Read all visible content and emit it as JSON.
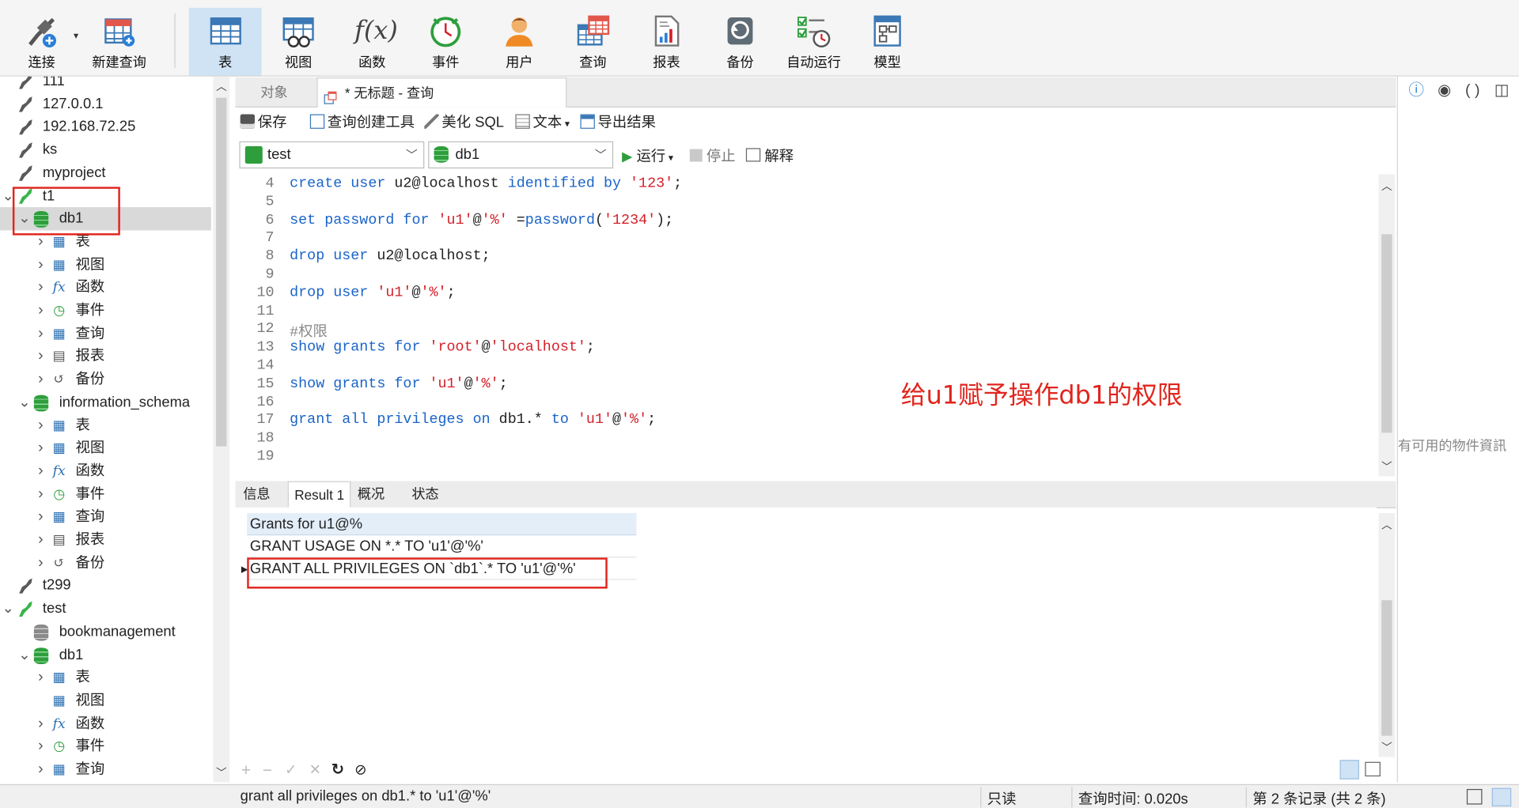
{
  "toolbar": {
    "items": [
      {
        "label": "连接",
        "icon": "plug-icon"
      },
      {
        "label": "新建查询",
        "icon": "new-query-icon"
      },
      {
        "label": "表",
        "icon": "table-icon"
      },
      {
        "label": "视图",
        "icon": "view-icon"
      },
      {
        "label": "函数",
        "icon": "function-icon"
      },
      {
        "label": "事件",
        "icon": "clock-icon"
      },
      {
        "label": "用户",
        "icon": "user-icon"
      },
      {
        "label": "查询",
        "icon": "query-icon"
      },
      {
        "label": "报表",
        "icon": "report-icon"
      },
      {
        "label": "备份",
        "icon": "backup-icon"
      },
      {
        "label": "自动运行",
        "icon": "schedule-icon"
      },
      {
        "label": "模型",
        "icon": "model-icon"
      }
    ],
    "active": "表"
  },
  "tree": {
    "rows": [
      {
        "label": "111",
        "kind": "connection",
        "state": "off"
      },
      {
        "label": "127.0.0.1",
        "kind": "connection",
        "state": "off"
      },
      {
        "label": "192.168.72.25",
        "kind": "connection",
        "state": "off"
      },
      {
        "label": "ks",
        "kind": "connection",
        "state": "off"
      },
      {
        "label": "myproject",
        "kind": "connection",
        "state": "off"
      },
      {
        "label": "t1",
        "kind": "connection",
        "state": "on",
        "expanded": true
      },
      {
        "label": "db1",
        "kind": "database",
        "state": "open",
        "expanded": true,
        "selected": true
      },
      {
        "label": "表",
        "kind": "tables"
      },
      {
        "label": "视图",
        "kind": "views"
      },
      {
        "label": "函数",
        "kind": "functions"
      },
      {
        "label": "事件",
        "kind": "events"
      },
      {
        "label": "查询",
        "kind": "queries"
      },
      {
        "label": "报表",
        "kind": "reports"
      },
      {
        "label": "备份",
        "kind": "backups"
      },
      {
        "label": "information_schema",
        "kind": "database",
        "state": "open",
        "expanded": true
      },
      {
        "label": "表",
        "kind": "tables"
      },
      {
        "label": "视图",
        "kind": "views"
      },
      {
        "label": "函数",
        "kind": "functions"
      },
      {
        "label": "事件",
        "kind": "events"
      },
      {
        "label": "查询",
        "kind": "queries"
      },
      {
        "label": "报表",
        "kind": "reports"
      },
      {
        "label": "备份",
        "kind": "backups"
      },
      {
        "label": "t299",
        "kind": "connection",
        "state": "off"
      },
      {
        "label": "test",
        "kind": "connection",
        "state": "on",
        "expanded": true
      },
      {
        "label": "bookmanagement",
        "kind": "database",
        "state": "closed"
      },
      {
        "label": "db1",
        "kind": "database",
        "state": "open",
        "expanded": true
      },
      {
        "label": "表",
        "kind": "tables"
      },
      {
        "label": "视图",
        "kind": "views"
      },
      {
        "label": "函数",
        "kind": "functions"
      },
      {
        "label": "事件",
        "kind": "events"
      },
      {
        "label": "查询",
        "kind": "queries"
      }
    ]
  },
  "tabs": {
    "objects": "对象",
    "query": "* 无标题 - 查询"
  },
  "query_toolbar": {
    "save": "保存",
    "builder": "查询创建工具",
    "beautify": "美化 SQL",
    "text": "文本",
    "export": "导出结果",
    "connection": "test",
    "database": "db1",
    "run": "运行",
    "stop": "停止",
    "explain": "解释"
  },
  "editor": {
    "lines": [
      {
        "n": "4",
        "tokens": [
          [
            "kw",
            "create user "
          ],
          [
            "plain",
            "u2@localhost "
          ],
          [
            "kw",
            "identified by "
          ],
          [
            "str",
            "'123'"
          ],
          [
            "plain",
            ";"
          ]
        ]
      },
      {
        "n": "5",
        "tokens": []
      },
      {
        "n": "6",
        "tokens": [
          [
            "kw",
            "set password for "
          ],
          [
            "str",
            "'u1'"
          ],
          [
            "plain",
            "@"
          ],
          [
            "str",
            "'%'"
          ],
          [
            "plain",
            " ="
          ],
          [
            "kw",
            "password"
          ],
          [
            "plain",
            "("
          ],
          [
            "str",
            "'1234'"
          ],
          [
            "plain",
            ");"
          ]
        ]
      },
      {
        "n": "7",
        "tokens": []
      },
      {
        "n": "8",
        "tokens": [
          [
            "kw",
            "drop user "
          ],
          [
            "plain",
            "u2@localhost;"
          ]
        ]
      },
      {
        "n": "9",
        "tokens": []
      },
      {
        "n": "10",
        "tokens": [
          [
            "kw",
            "drop user "
          ],
          [
            "str",
            "'u1'"
          ],
          [
            "plain",
            "@"
          ],
          [
            "str",
            "'%'"
          ],
          [
            "plain",
            ";"
          ]
        ]
      },
      {
        "n": "11",
        "tokens": []
      },
      {
        "n": "12",
        "tokens": [
          [
            "cmt",
            "#权限"
          ]
        ]
      },
      {
        "n": "13",
        "tokens": [
          [
            "kw",
            "show grants for "
          ],
          [
            "str",
            "'root'"
          ],
          [
            "plain",
            "@"
          ],
          [
            "str",
            "'localhost'"
          ],
          [
            "plain",
            ";"
          ]
        ]
      },
      {
        "n": "14",
        "tokens": []
      },
      {
        "n": "15",
        "tokens": [
          [
            "kw",
            "show grants for "
          ],
          [
            "str",
            "'u1'"
          ],
          [
            "plain",
            "@"
          ],
          [
            "str",
            "'%'"
          ],
          [
            "plain",
            ";"
          ]
        ]
      },
      {
        "n": "16",
        "tokens": []
      },
      {
        "n": "17",
        "tokens": [
          [
            "kw",
            "grant all privileges on "
          ],
          [
            "plain",
            "db1.* "
          ],
          [
            "kw",
            "to "
          ],
          [
            "str",
            "'u1'"
          ],
          [
            "plain",
            "@"
          ],
          [
            "str",
            "'%'"
          ],
          [
            "plain",
            ";"
          ]
        ]
      },
      {
        "n": "18",
        "tokens": []
      },
      {
        "n": "19",
        "tokens": []
      }
    ],
    "annotation": "给u1赋予操作db1的权限"
  },
  "result_tabs": [
    "信息",
    "Result 1",
    "概况",
    "状态"
  ],
  "result_active": "Result 1",
  "result": {
    "header": "Grants for u1@%",
    "rows": [
      "GRANT USAGE ON *.* TO 'u1'@'%'",
      "GRANT ALL PRIVILEGES ON `db1`.* TO 'u1'@'%'"
    ]
  },
  "right_panel": {
    "empty_text": "有可用的物件資訊"
  },
  "status": {
    "sql": "grant all privileges on db1.* to 'u1'@'%'",
    "mode": "只读",
    "time": "查询时间: 0.020s",
    "records": "第 2 条记录 (共 2 条)"
  }
}
